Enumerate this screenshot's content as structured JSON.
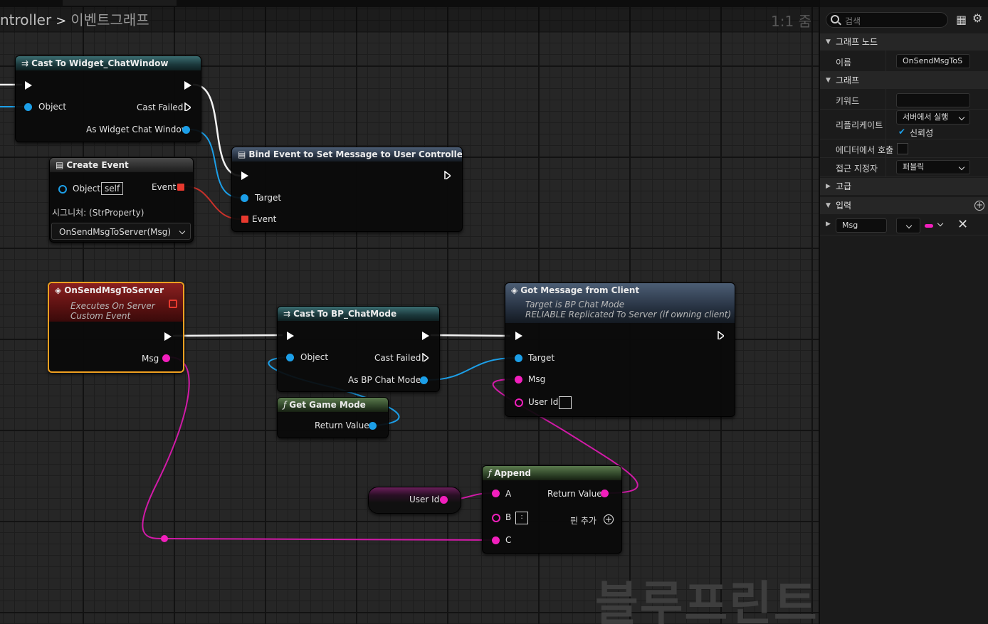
{
  "breadcrumb": {
    "parent": "ntroller",
    "separator": ">",
    "current": "이벤트그래프"
  },
  "zoom_label": "1:1 줌",
  "watermark": "블루프린트",
  "nodes": {
    "cast_widget": {
      "title": "Cast To Widget_ChatWindow",
      "object_label": "Object",
      "cast_failed": "Cast Failed",
      "as_output": "As Widget Chat Window"
    },
    "create_event": {
      "title": "Create Event",
      "object_label": "Object",
      "object_value": "self",
      "event_label": "Event",
      "signature": "시그니처: (StrProperty)",
      "function_select": "OnSendMsgToServer(Msg)"
    },
    "bind_event": {
      "title": "Bind Event to Set Message to User Controller",
      "target_label": "Target",
      "event_label": "Event"
    },
    "on_send": {
      "title": "OnSendMsgToServer",
      "sub1": "Executes On Server",
      "sub2": "Custom Event",
      "msg_label": "Msg"
    },
    "cast_chatmode": {
      "title": "Cast To BP_ChatMode",
      "object_label": "Object",
      "cast_failed": "Cast Failed",
      "as_output": "As BP Chat Mode"
    },
    "get_game_mode": {
      "title": "Get Game Mode",
      "return_label": "Return Value"
    },
    "got_message": {
      "title": "Got Message from Client",
      "sub1": "Target is BP Chat Mode",
      "sub2": "RELIABLE Replicated To Server (if owning client)",
      "target_label": "Target",
      "msg_label": "Msg",
      "userid_label": "User Id"
    },
    "userid_var": {
      "label": "User Id"
    },
    "append": {
      "title": "Append",
      "a_label": "A",
      "b_label": "B",
      "b_value": ":",
      "c_label": "C",
      "return_label": "Return Value",
      "add_pin": "핀 추가"
    }
  },
  "details_panel": {
    "search_placeholder": "검색",
    "sections": {
      "graph_node": "그래프 노드",
      "graph": "그래프",
      "advanced": "고급",
      "inputs": "입력"
    },
    "name_label": "이름",
    "name_value": "OnSendMsgToS",
    "keywords_label": "키워드",
    "keywords_value": "",
    "replicates_label": "리플리케이트",
    "replicates_value": "서버에서 실행",
    "reliable_label": "신뢰성",
    "reliable_checked": true,
    "call_in_editor_label": "에디터에서 호출",
    "call_in_editor_checked": false,
    "access_label": "접근 지정자",
    "access_value": "퍼블릭",
    "input_param_name": "Msg",
    "input_param_color": "#f21fbd"
  },
  "colors": {
    "exec": "#ffffff",
    "object_pin": "#1c9fe8",
    "string_pin": "#f21fbd",
    "delegate_pin": "#e8392e",
    "selection": "#f0a020"
  }
}
